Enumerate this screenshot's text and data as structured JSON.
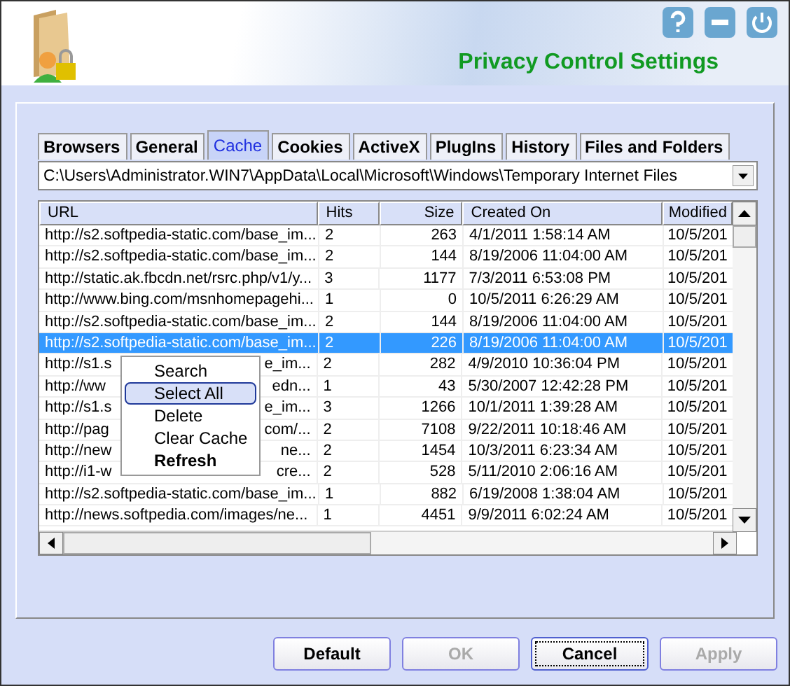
{
  "header": {
    "title": "Privacy Control Settings"
  },
  "tabs": [
    {
      "label": "Browsers",
      "selected": false
    },
    {
      "label": "General",
      "selected": false
    },
    {
      "label": "Cache",
      "selected": true
    },
    {
      "label": "Cookies",
      "selected": false
    },
    {
      "label": "ActiveX",
      "selected": false
    },
    {
      "label": "PlugIns",
      "selected": false
    },
    {
      "label": "History",
      "selected": false
    },
    {
      "label": "Files and Folders",
      "selected": false
    }
  ],
  "path": "C:\\Users\\Administrator.WIN7\\AppData\\Local\\Microsoft\\Windows\\Temporary Internet Files",
  "table": {
    "columns": [
      "URL",
      "Hits",
      "Size",
      "Created On",
      "Modified"
    ],
    "rows": [
      {
        "url": "http://s2.softpedia-static.com/base_im...",
        "hits": "2",
        "size": "263",
        "created": "4/1/2011 1:58:14 AM",
        "modified": "10/5/201",
        "selected": false
      },
      {
        "url": "http://s2.softpedia-static.com/base_im...",
        "hits": "2",
        "size": "144",
        "created": "8/19/2006 11:04:00 AM",
        "modified": "10/5/201",
        "selected": false
      },
      {
        "url": "http://static.ak.fbcdn.net/rsrc.php/v1/y...",
        "hits": "3",
        "size": "1177",
        "created": "7/3/2011 6:53:08 PM",
        "modified": "10/5/201",
        "selected": false
      },
      {
        "url": "http://www.bing.com/msnhomepagehi...",
        "hits": "1",
        "size": "0",
        "created": "10/5/2011 6:26:29 AM",
        "modified": "10/5/201",
        "selected": false
      },
      {
        "url": "http://s2.softpedia-static.com/base_im...",
        "hits": "2",
        "size": "144",
        "created": "8/19/2006 11:04:00 AM",
        "modified": "10/5/201",
        "selected": false
      },
      {
        "url": "http://s2.softpedia-static.com/base_im...",
        "hits": "2",
        "size": "226",
        "created": "8/19/2006 11:04:00 AM",
        "modified": "10/5/201",
        "selected": true
      },
      {
        "url": "http://s1.s",
        "url_end": "e_im...",
        "hits": "2",
        "size": "282",
        "created": "4/9/2010 10:36:04 PM",
        "modified": "10/5/201",
        "selected": false
      },
      {
        "url": "http://ww",
        "url_end": "edn...",
        "hits": "1",
        "size": "43",
        "created": "5/30/2007 12:42:28 PM",
        "modified": "10/5/201",
        "selected": false
      },
      {
        "url": "http://s1.s",
        "url_end": "e_im...",
        "hits": "3",
        "size": "1266",
        "created": "10/1/2011 1:39:28 AM",
        "modified": "10/5/201",
        "selected": false
      },
      {
        "url": "http://pag",
        "url_end": "com/...",
        "hits": "2",
        "size": "7108",
        "created": "9/22/2011 10:18:46 AM",
        "modified": "10/5/201",
        "selected": false
      },
      {
        "url": "http://new",
        "url_end": "ne...",
        "hits": "2",
        "size": "1454",
        "created": "10/3/2011 6:23:34 AM",
        "modified": "10/5/201",
        "selected": false
      },
      {
        "url": "http://i1-w",
        "url_end": "cre...",
        "hits": "2",
        "size": "528",
        "created": "5/11/2010 2:06:16 AM",
        "modified": "10/5/201",
        "selected": false
      },
      {
        "url": "http://s2.softpedia-static.com/base_im...",
        "hits": "1",
        "size": "882",
        "created": "6/19/2008 1:38:04 AM",
        "modified": "10/5/201",
        "selected": false
      },
      {
        "url": "http://news.softpedia.com/images/ne...",
        "hits": "1",
        "size": "4451",
        "created": "9/9/2011 6:02:24 AM",
        "modified": "10/5/201",
        "selected": false
      }
    ]
  },
  "context_menu": [
    {
      "label": "Search",
      "selected": false,
      "bold": false
    },
    {
      "label": "Select All",
      "selected": true,
      "bold": false
    },
    {
      "label": "Delete",
      "selected": false,
      "bold": false
    },
    {
      "label": "Clear Cache",
      "selected": false,
      "bold": false
    },
    {
      "label": "Refresh",
      "selected": false,
      "bold": true
    }
  ],
  "buttons": [
    {
      "label": "Default",
      "disabled": false,
      "focused": false
    },
    {
      "label": "OK",
      "disabled": true,
      "focused": false
    },
    {
      "label": "Cancel",
      "disabled": false,
      "focused": true
    },
    {
      "label": "Apply",
      "disabled": true,
      "focused": false
    }
  ]
}
